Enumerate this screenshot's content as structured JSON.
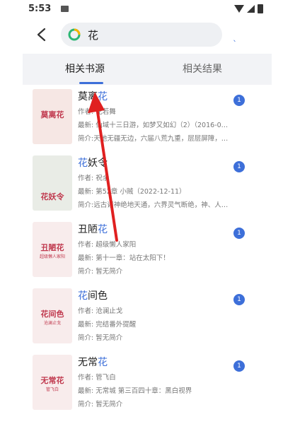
{
  "status_bar": {
    "time": "5:53"
  },
  "search": {
    "query": "花",
    "more_button": "ˎ"
  },
  "tabs": [
    {
      "label": "相关书源"
    },
    {
      "label": "相关结果"
    }
  ],
  "results": [
    {
      "title_before": "莫离",
      "title_highlight": "花",
      "title_after": "",
      "author": "作者: 花若舞",
      "latest": "最新: 仙域十三日游，如梦又如幻（2）（2016-03-08）",
      "intro": "简介:天地无疆无边，六届八荒九重，层层屏障，重…",
      "badge": "1",
      "cover": {
        "text": "莫离花",
        "sub": "",
        "bg": "#f6e7e4"
      }
    },
    {
      "title_before": "",
      "title_highlight": "花",
      "title_after": "妖令",
      "author": "作者: 祝余",
      "latest": "最新: 第52章 小贼（2022-12-11）",
      "intro": "简介:远古诸神绝地天通，六界灵气断绝，神、人、…",
      "badge": "1",
      "cover": {
        "text": "花妖令",
        "sub": "",
        "bg": "#e9ece6"
      }
    },
    {
      "title_before": "丑陋",
      "title_highlight": "花",
      "title_after": "",
      "author": "作者: 超级懒人家阳",
      "latest": "最新: 第十一章：站在太阳下！",
      "intro": "简介: 暂无简介",
      "badge": "1",
      "cover": {
        "text": "丑陋花",
        "sub": "超级懒人家阳",
        "bg": "#f8ecec"
      }
    },
    {
      "title_before": "",
      "title_highlight": "花",
      "title_after": "间色",
      "author": "作者: 沧澜止戈",
      "latest": "最新: 完结番外提醒",
      "intro": "简介: 暂无简介",
      "badge": "1",
      "cover": {
        "text": "花间色",
        "sub": "沧澜止戈",
        "bg": "#f8ecec"
      }
    },
    {
      "title_before": "无常",
      "title_highlight": "花",
      "title_after": "",
      "author": "作者: 管飞白",
      "latest": "最新: 无常城 第三百四十章：黑白视界",
      "intro": "简介: 暂无简介",
      "badge": "1",
      "cover": {
        "text": "无常花",
        "sub": "管飞白",
        "bg": "#f8ecec"
      }
    }
  ],
  "colors": {
    "accent": "#3d6fd9",
    "annotation_arrow": "#e02020"
  }
}
